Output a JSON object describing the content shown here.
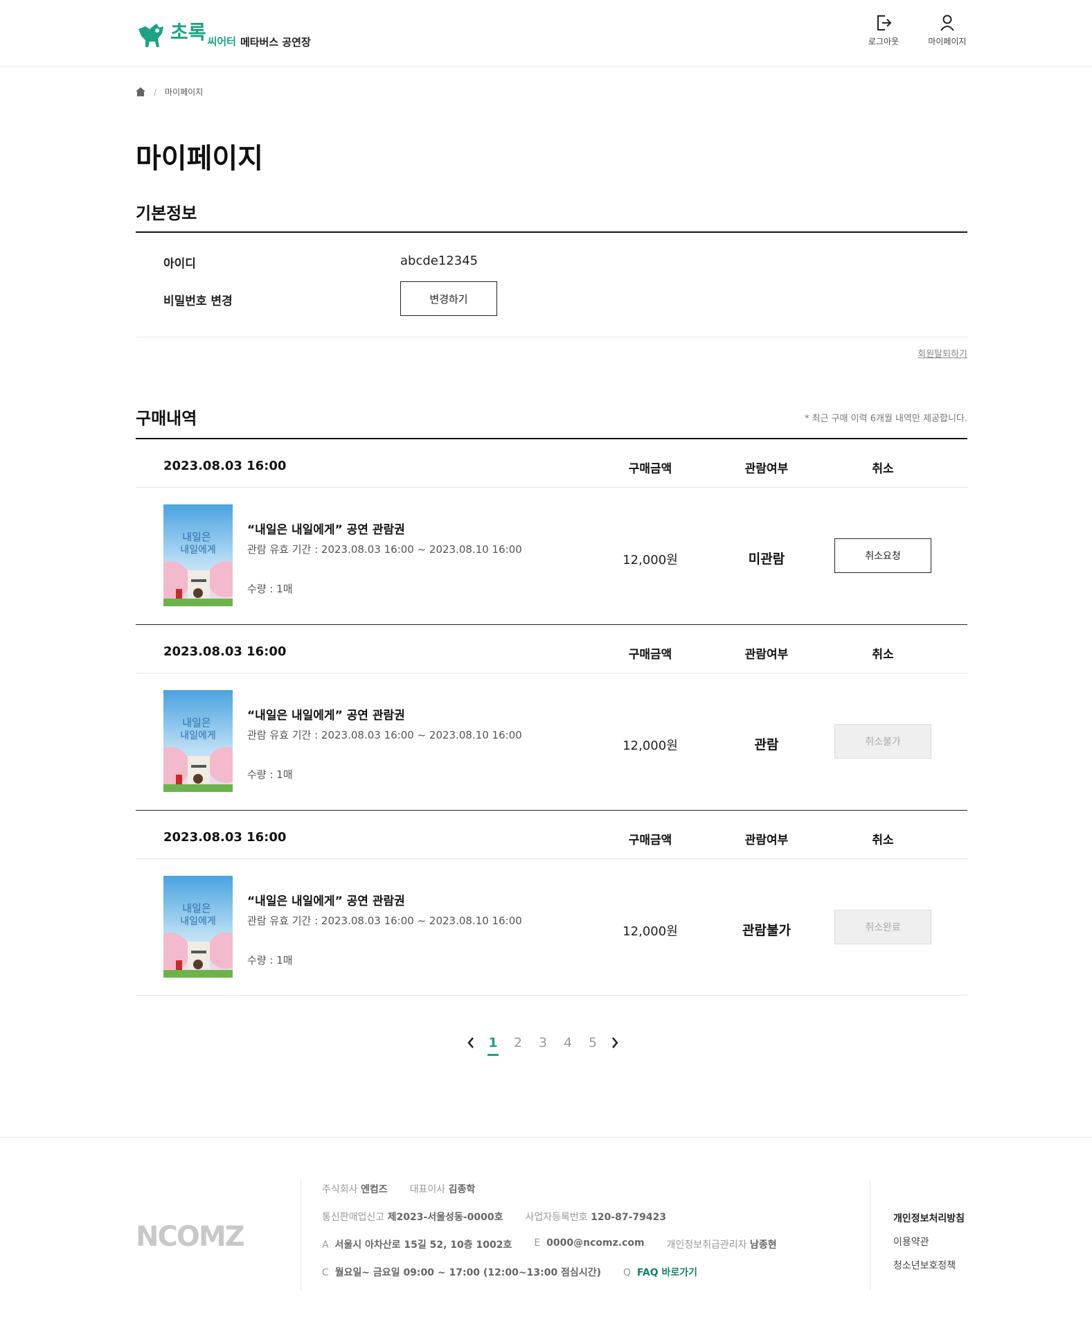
{
  "header": {
    "logo_main": "초록",
    "logo_small": "씨어터",
    "logo_sub": "메타버스 공연장",
    "logout_label": "로그아웃",
    "mypage_label": "마이페이지"
  },
  "breadcrumb": {
    "current": "마이페이지"
  },
  "page_title": "마이페이지",
  "basic_info": {
    "title": "기본정보",
    "id_label": "아이디",
    "id_value": "abcde12345",
    "password_label": "비밀번호 변경",
    "change_button": "변경하기",
    "withdraw_link": "회원탈퇴하기"
  },
  "purchases": {
    "title": "구매내역",
    "note": "* 최근 구매 이력 6개월 내역만 제공합니다.",
    "col_amount": "구매금액",
    "col_view": "관람여부",
    "col_cancel": "취소",
    "orders": [
      {
        "date": "2023.08.03 16:00",
        "title": "“내일은 내일에게” 공연 관람권",
        "period": "관람 유효 기간 : 2023.08.03 16:00 ~ 2023.08.10 16:00",
        "qty": "수량 : 1매",
        "amount": "12,000원",
        "status": "미관람",
        "action": "취소요청",
        "action_enabled": true
      },
      {
        "date": "2023.08.03 16:00",
        "title": "“내일은 내일에게” 공연 관람권",
        "period": "관람 유효 기간 : 2023.08.03 16:00 ~ 2023.08.10 16:00",
        "qty": "수량 : 1매",
        "amount": "12,000원",
        "status": "관람",
        "action": "취소불가",
        "action_enabled": false
      },
      {
        "date": "2023.08.03 16:00",
        "title": "“내일은 내일에게” 공연 관람권",
        "period": "관람 유효 기간 : 2023.08.03 16:00 ~ 2023.08.10 16:00",
        "qty": "수량 : 1매",
        "amount": "12,000원",
        "status": "관람불가",
        "action": "취소완료",
        "action_enabled": false
      }
    ]
  },
  "pagination": {
    "pages": [
      "1",
      "2",
      "3",
      "4",
      "5"
    ],
    "current": "1"
  },
  "poster_text": {
    "line1": "내일은",
    "line2": "내일에게"
  },
  "footer": {
    "logo": "NCOMZ",
    "company_label": "주식회사",
    "company": "엔컴즈",
    "ceo_label": "대표이사",
    "ceo": "김종학",
    "mail_order_label": "통신판매업신고",
    "mail_order": "제2023-서울성동-0000호",
    "biz_label": "사업자등록번호",
    "biz": "120-87-79423",
    "addr_key": "A",
    "addr": "서울시 아차산로 15길 52, 10층 1002호",
    "email_key": "E",
    "email": "0000@ncomz.com",
    "privacy_mgr_label": "개인정보취급관리자",
    "privacy_mgr": "남종현",
    "cs_key": "C",
    "cs": "월요일~ 금요일 09:00 ~ 17:00 (12:00~13:00 점심시간)",
    "faq_key": "Q",
    "faq": "FAQ 바로가기",
    "links": [
      "개인정보처리방침",
      "이용약관",
      "청소년보호정책"
    ]
  },
  "colors": {
    "accent": "#1aa383",
    "text": "#111111",
    "muted": "#999999"
  }
}
